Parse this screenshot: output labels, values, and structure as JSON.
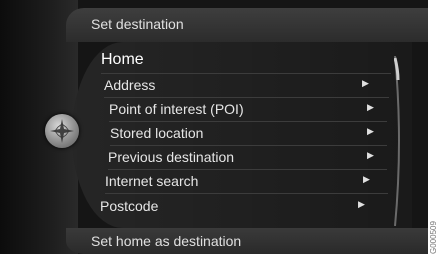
{
  "header": {
    "title": "Set destination"
  },
  "menu": {
    "items": [
      {
        "label": "Home",
        "selected": true,
        "has_arrow": false
      },
      {
        "label": "Address",
        "has_arrow": true
      },
      {
        "label": "Point of interest (POI)",
        "has_arrow": true
      },
      {
        "label": "Stored location",
        "has_arrow": true
      },
      {
        "label": "Previous destination",
        "has_arrow": true
      },
      {
        "label": "Internet search",
        "has_arrow": true
      },
      {
        "label": "Postcode",
        "has_arrow": true
      }
    ]
  },
  "footer": {
    "text": "Set home as destination"
  },
  "icons": {
    "left": "compass-rose-icon",
    "arrow": "triangle-right-icon"
  },
  "watermark": "G000509"
}
